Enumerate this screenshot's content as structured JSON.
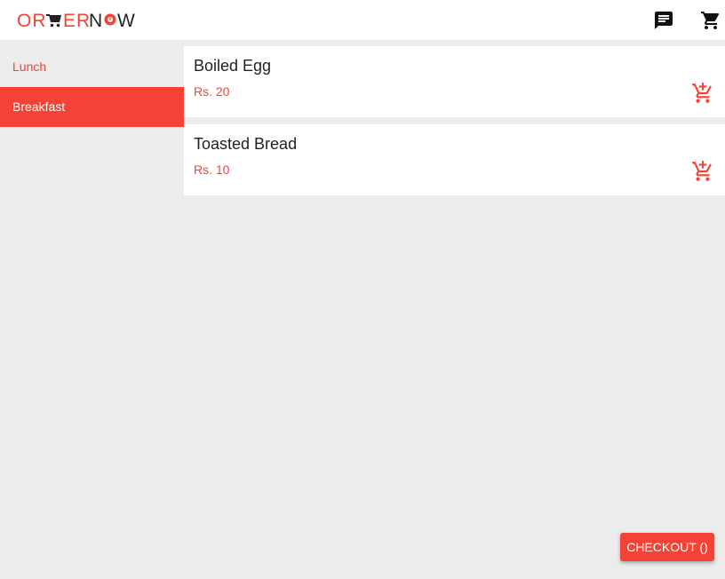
{
  "header": {
    "logo_text": "ORDER NOW",
    "icons": [
      "message-icon",
      "cart-icon"
    ]
  },
  "sidebar": {
    "items": [
      {
        "label": "Lunch",
        "active": false
      },
      {
        "label": "Breakfast",
        "active": true
      }
    ]
  },
  "menu": {
    "items": [
      {
        "name": "Boiled Egg",
        "price": "Rs. 20"
      },
      {
        "name": "Toasted Bread",
        "price": "Rs. 10"
      }
    ]
  },
  "checkout": {
    "label": "CHECKOUT ()"
  },
  "colors": {
    "accent": "#f44336",
    "background": "#ececec",
    "surface": "#ffffff"
  }
}
